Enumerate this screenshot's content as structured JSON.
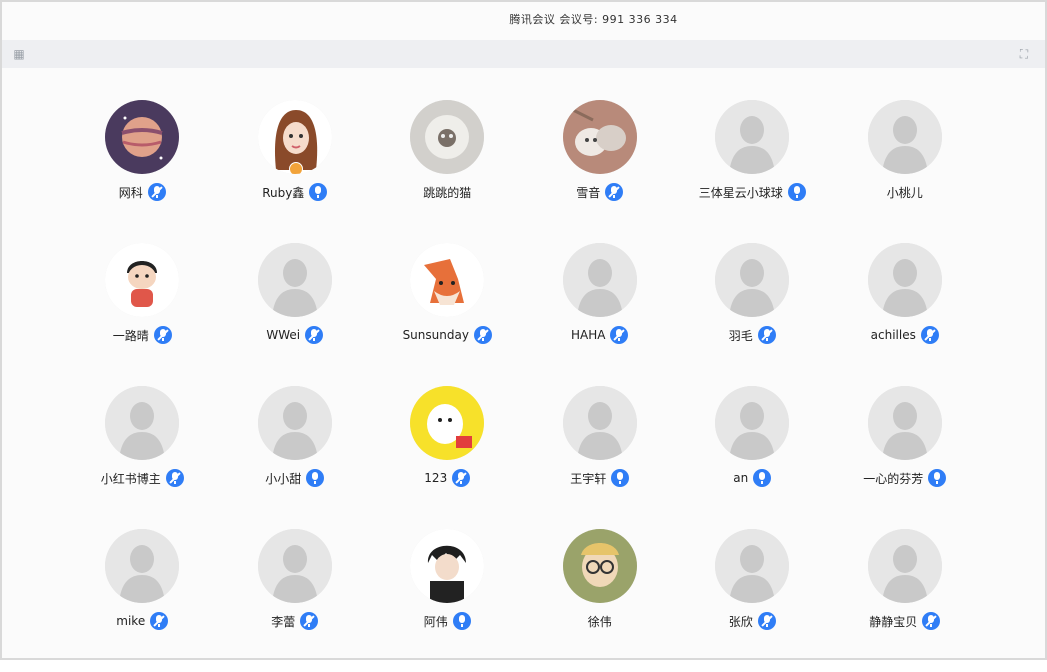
{
  "meeting": {
    "info": "腾讯会议 会议号: 991 336 334"
  },
  "colors": {
    "accent": "#2f7df6",
    "placeholder": "#e6e6e6",
    "silhouette": "#c9c9c9"
  },
  "participants": [
    {
      "name": "网科",
      "avatar": "planet",
      "mic": "muted"
    },
    {
      "name": "Ruby鑫",
      "avatar": "cartoon-girl",
      "mic": "on"
    },
    {
      "name": "跳跳的猫",
      "avatar": "photo-grey",
      "mic": "none"
    },
    {
      "name": "雪音",
      "avatar": "cats-photo",
      "mic": "muted"
    },
    {
      "name": "三体星云小球球",
      "avatar": "default",
      "mic": "on"
    },
    {
      "name": "小桃儿",
      "avatar": "default",
      "mic": "none"
    },
    {
      "name": "一路晴",
      "avatar": "boy-cartoon",
      "mic": "muted"
    },
    {
      "name": "WWei",
      "avatar": "default",
      "mic": "muted"
    },
    {
      "name": "Sunsunday",
      "avatar": "fox",
      "mic": "muted"
    },
    {
      "name": "HAHA",
      "avatar": "default",
      "mic": "muted"
    },
    {
      "name": "羽毛",
      "avatar": "default",
      "mic": "muted"
    },
    {
      "name": "achilles",
      "avatar": "default",
      "mic": "muted"
    },
    {
      "name": "小红书博主",
      "avatar": "default",
      "mic": "muted"
    },
    {
      "name": "小小甜",
      "avatar": "default",
      "mic": "on"
    },
    {
      "name": "123",
      "avatar": "yellow-cartoon",
      "mic": "muted"
    },
    {
      "name": "王宇轩",
      "avatar": "default",
      "mic": "on"
    },
    {
      "name": "an",
      "avatar": "default",
      "mic": "on"
    },
    {
      "name": "一心的芬芳",
      "avatar": "default",
      "mic": "on"
    },
    {
      "name": "mike",
      "avatar": "default",
      "mic": "muted"
    },
    {
      "name": "李蕾",
      "avatar": "default",
      "mic": "muted"
    },
    {
      "name": "阿伟",
      "avatar": "anime-boy",
      "mic": "on"
    },
    {
      "name": "徐伟",
      "avatar": "glasses-cartoon",
      "mic": "none"
    },
    {
      "name": "张欣",
      "avatar": "default",
      "mic": "muted"
    },
    {
      "name": "静静宝贝",
      "avatar": "default",
      "mic": "muted"
    }
  ]
}
